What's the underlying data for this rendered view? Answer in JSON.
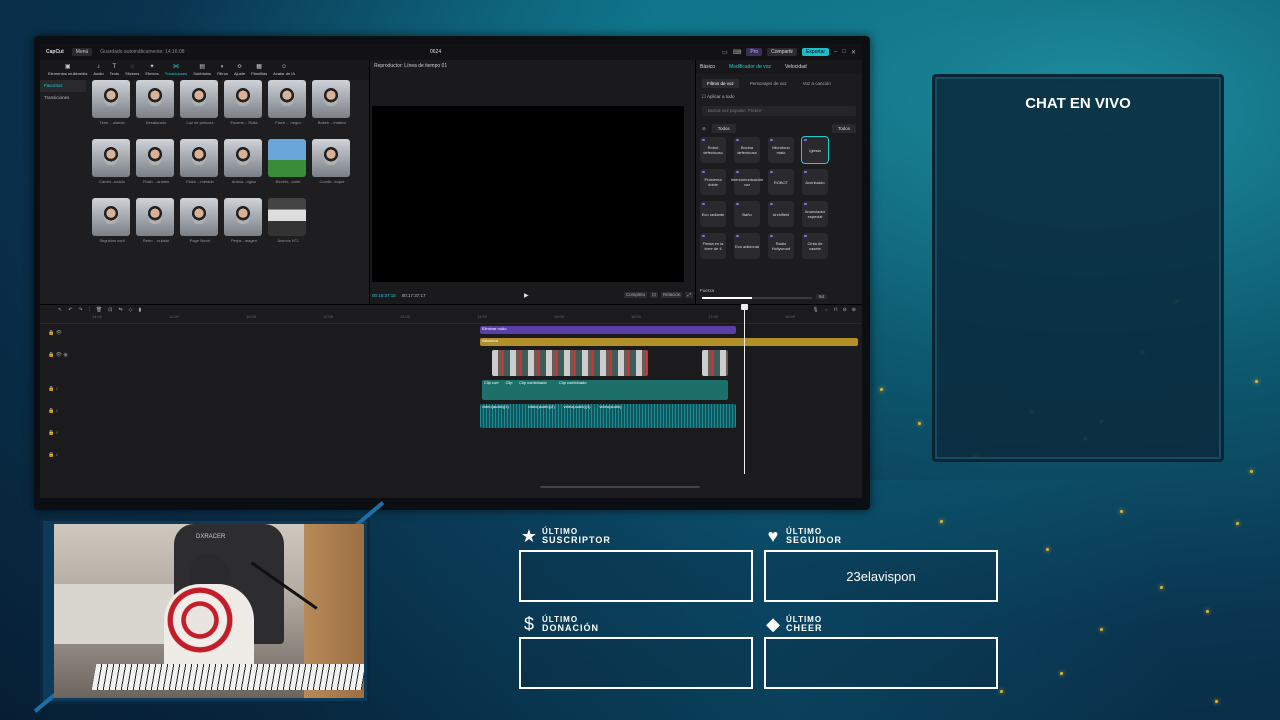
{
  "editor": {
    "app_name": "CapCut",
    "menu_label": "Menú",
    "saved_status": "Guardado automáticamente: 14:16:08",
    "project_name": "0624",
    "pro_label": "Pro",
    "share_label": "Compartir",
    "export_label": "Exportar",
    "media_tabs": [
      {
        "icon": "▣",
        "label": "Elementos multimedia"
      },
      {
        "icon": "♪",
        "label": "Audio"
      },
      {
        "icon": "T",
        "label": "Texto"
      },
      {
        "icon": "◌",
        "label": "Stickers"
      },
      {
        "icon": "✦",
        "label": "Efectos"
      },
      {
        "icon": "⋈",
        "label": "Transiciones"
      },
      {
        "icon": "▤",
        "label": "Subtítulos"
      },
      {
        "icon": "◐",
        "label": "Filtros"
      },
      {
        "icon": "≎",
        "label": "Ajuste"
      },
      {
        "icon": "▦",
        "label": "Plantillas"
      },
      {
        "icon": "☺",
        "label": "Avatar de IA"
      }
    ],
    "media_left": [
      "Favoritos",
      "Transiciones"
    ],
    "transitions": [
      {
        "label": "Tirón ...ulando",
        "type": "person"
      },
      {
        "label": "Desaturado",
        "type": "person"
      },
      {
        "label": "Luz de película",
        "type": "person"
      },
      {
        "label": "Escene... Rolla",
        "type": "person"
      },
      {
        "label": "Flash ... negro",
        "type": "person"
      },
      {
        "label": "Bokeh ...imático",
        "type": "person"
      },
      {
        "label": "Cambi...ozado",
        "type": "person"
      },
      {
        "label": "Flash ...anales",
        "type": "person"
      },
      {
        "label": "Flash ...metado",
        "type": "person"
      },
      {
        "label": "Anima...ógico",
        "type": "person"
      },
      {
        "label": "Revelo...corte",
        "type": "land"
      },
      {
        "label": "Combi...toque",
        "type": "person"
      },
      {
        "label": "Seguidos corti",
        "type": "person"
      },
      {
        "label": "Retro ...nulado",
        "type": "person"
      },
      {
        "label": "Page Novel",
        "type": "person"
      },
      {
        "label": "Perps...magen",
        "type": "person"
      },
      {
        "label": "Ánimos N°2",
        "type": "mountain"
      }
    ],
    "player_title": "Reproductor: Línea de tiempo 01",
    "time_current": "00:16:37:16",
    "time_total": "00:17:37:17",
    "player_btn_1": "Completo",
    "player_btn_2": "Relación",
    "props_tabs": [
      "Básico",
      "Modificador de voz",
      "Velocidad"
    ],
    "props_subtabs": [
      "Filtros de voz",
      "Personajes de voz",
      "Voz a canción"
    ],
    "apply_all": "Aplicar a todo",
    "voice_search_placeholder": "Busca voz popular: 'Fiebre'",
    "filter_all": "Todos",
    "filter_right": "Todos",
    "voices": [
      "Robot defectuoso",
      "Bocina defectuosa",
      "Micrófono malo",
      "Iglesia",
      "Problema doble",
      "Intercomunicación voz",
      "ROBOT",
      "Acentuado",
      "Eco radiante",
      "Baño",
      "Archifield",
      "Anunciador especial",
      "Fiesta en la torre de 4",
      "Eco adicional",
      "Radio Hollywood",
      "Cinta de casete"
    ],
    "intensity_label": "Fuerza",
    "intensity_value": "54",
    "ruler_ticks": [
      "14:00",
      "11:00",
      "16:00",
      "12:00",
      "13:00",
      "14:00",
      "15:00",
      "16:00",
      "17:00",
      "18:00"
    ],
    "clips": {
      "effect_label": "Eliminar ruido",
      "audio_label": "Alfombra",
      "clip_labels": [
        "Clip corr",
        "Clip",
        "Clip combinado",
        "Clip combinado"
      ],
      "wave_labels": [
        "video(audio)(1)",
        "video(audio)(2)",
        "video(audio)(3)",
        "video(audio)"
      ]
    }
  },
  "chat": {
    "title": "CHAT EN VIVO"
  },
  "webcam": {
    "chair_brand": "DXRACER"
  },
  "stats": {
    "subscriber": {
      "icon": "★",
      "line1": "ÚLTIMO",
      "line2": "SUSCRIPTOR",
      "value": ""
    },
    "follower": {
      "icon": "♥",
      "line1": "ÚLTIMO",
      "line2": "SEGUIDOR",
      "value": "23elavispon"
    },
    "donation": {
      "icon": "$",
      "line1": "ÚLTIMO",
      "line2": "DONACIÓN",
      "value": ""
    },
    "cheer": {
      "icon": "◆",
      "line1": "ÚLTIMO",
      "line2": "CHEER",
      "value": ""
    }
  },
  "colors": {
    "accent": "#19d0d0",
    "particle": "#e6b42a",
    "effect_track": "#5a3fa8",
    "audio_track": "#b38f2a"
  }
}
